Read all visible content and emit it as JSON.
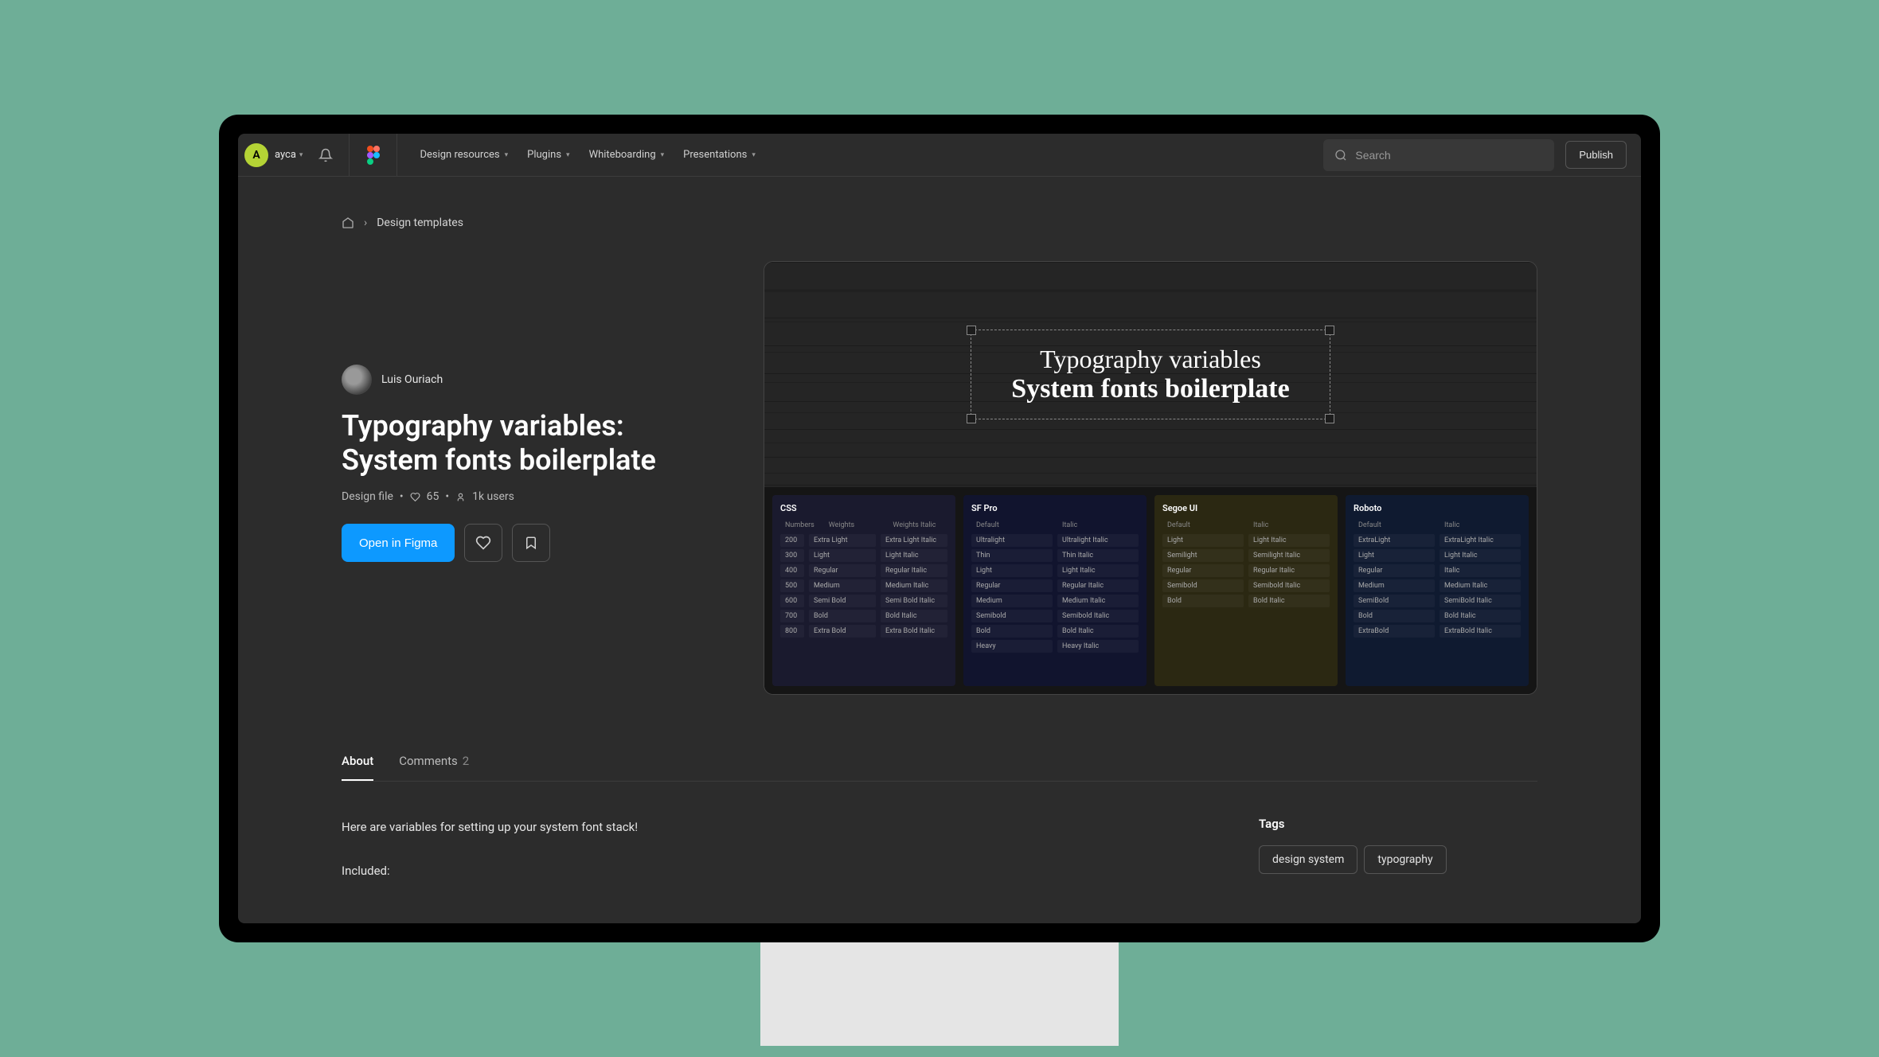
{
  "nav": {
    "avatar_initial": "A",
    "username": "ayca",
    "items": [
      "Design resources",
      "Plugins",
      "Whiteboarding",
      "Presentations"
    ],
    "search_placeholder": "Search",
    "publish": "Publish"
  },
  "breadcrumb": {
    "section": "Design templates"
  },
  "resource": {
    "author": "Luis Ouriach",
    "title": "Typography variables: System fonts boilerplate",
    "type": "Design file",
    "likes": "65",
    "users": "1k users",
    "open_label": "Open in Figma"
  },
  "preview": {
    "line1": "Typography variables",
    "line2": "System fonts boilerplate",
    "cards": {
      "css": {
        "title": "CSS",
        "headers": [
          "Numbers",
          "Weights",
          "Weights Italic"
        ],
        "rows": [
          [
            "200",
            "Extra Light",
            "Extra Light Italic"
          ],
          [
            "300",
            "Light",
            "Light Italic"
          ],
          [
            "400",
            "Regular",
            "Regular Italic"
          ],
          [
            "500",
            "Medium",
            "Medium Italic"
          ],
          [
            "600",
            "Semi Bold",
            "Semi Bold Italic"
          ],
          [
            "700",
            "Bold",
            "Bold Italic"
          ],
          [
            "800",
            "Extra Bold",
            "Extra Bold Italic"
          ]
        ]
      },
      "sfpro": {
        "title": "SF Pro",
        "headers": [
          "Default",
          "Italic"
        ],
        "rows": [
          [
            "Ultralight",
            "Ultralight Italic"
          ],
          [
            "Thin",
            "Thin Italic"
          ],
          [
            "Light",
            "Light Italic"
          ],
          [
            "Regular",
            "Regular Italic"
          ],
          [
            "Medium",
            "Medium Italic"
          ],
          [
            "Semibold",
            "Semibold Italic"
          ],
          [
            "Bold",
            "Bold Italic"
          ],
          [
            "Heavy",
            "Heavy Italic"
          ]
        ]
      },
      "segoe": {
        "title": "Segoe UI",
        "headers": [
          "Default",
          "Italic"
        ],
        "rows": [
          [
            "Light",
            "Light Italic"
          ],
          [
            "Semilight",
            "Semilight Italic"
          ],
          [
            "Regular",
            "Regular Italic"
          ],
          [
            "Semibold",
            "Semibold Italic"
          ],
          [
            "Bold",
            "Bold Italic"
          ]
        ]
      },
      "roboto": {
        "title": "Roboto",
        "headers": [
          "Default",
          "Italic"
        ],
        "rows": [
          [
            "ExtraLight",
            "ExtraLight Italic"
          ],
          [
            "Light",
            "Light Italic"
          ],
          [
            "Regular",
            "Italic"
          ],
          [
            "Medium",
            "Medium Italic"
          ],
          [
            "SemiBold",
            "SemiBold Italic"
          ],
          [
            "Bold",
            "Bold Italic"
          ],
          [
            "ExtraBold",
            "ExtraBold Italic"
          ]
        ]
      }
    }
  },
  "tabs": {
    "about": "About",
    "comments": "Comments",
    "comments_count": "2"
  },
  "description": {
    "p1": "Here are variables for setting up your system font stack!",
    "p2": "Included:"
  },
  "tags": {
    "title": "Tags",
    "items": [
      "design system",
      "typography"
    ]
  }
}
